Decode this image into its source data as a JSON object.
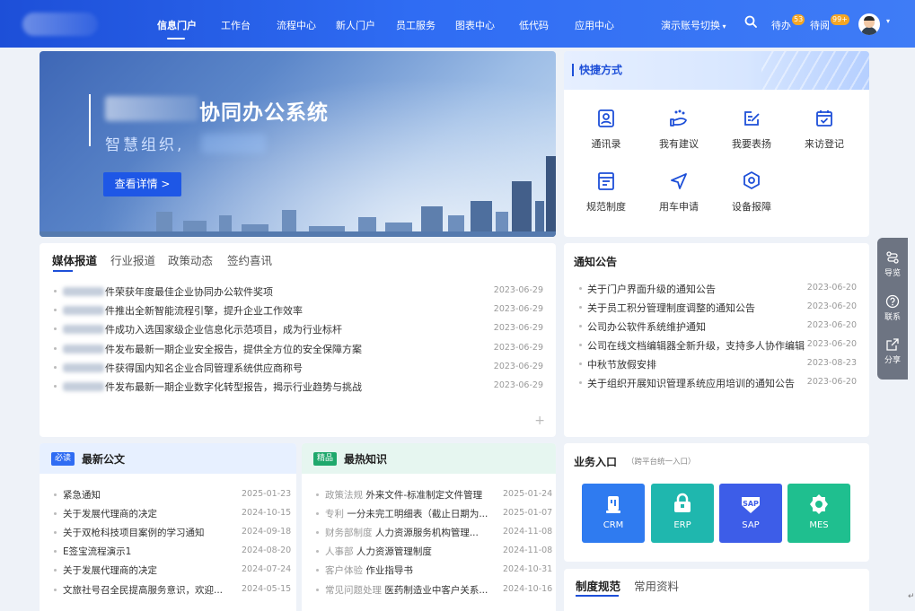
{
  "nav": {
    "items": [
      "信息门户",
      "工作台",
      "流程中心",
      "新人门户",
      "员工服务",
      "图表中心",
      "低代码",
      "应用中心"
    ],
    "active": "信息门户",
    "account_switch": "演示账号切换",
    "todo_label": "待办",
    "todo_count": "53",
    "toread_label": "待阅",
    "toread_count": "99+"
  },
  "banner": {
    "title": "协同办公系统",
    "subtitle": "智慧组织,",
    "button": "查看详情 >"
  },
  "quick": {
    "title": "快捷方式",
    "items": [
      {
        "label": "通讯录",
        "icon": "contact-book-icon"
      },
      {
        "label": "我有建议",
        "icon": "suggestion-icon"
      },
      {
        "label": "我要表扬",
        "icon": "praise-icon"
      },
      {
        "label": "来访登记",
        "icon": "visitor-register-icon"
      },
      {
        "label": "规范制度",
        "icon": "regulation-icon"
      },
      {
        "label": "用车申请",
        "icon": "car-request-icon"
      },
      {
        "label": "设备报障",
        "icon": "device-repair-icon"
      }
    ]
  },
  "media": {
    "tabs": [
      "媒体报道",
      "行业报道",
      "政策动态",
      "签约喜讯"
    ],
    "items": [
      {
        "title": "件荣获年度最佳企业协同办公软件奖项",
        "date": "2023-06-29"
      },
      {
        "title": "件推出全新智能流程引擎，提升企业工作效率",
        "date": "2023-06-29"
      },
      {
        "title": "件成功入选国家级企业信息化示范项目，成为行业标杆",
        "date": "2023-06-29"
      },
      {
        "title": "件发布最新一期企业安全报告，提供全方位的安全保障方案",
        "date": "2023-06-29"
      },
      {
        "title": "件获得国内知名企业合同管理系统供应商称号",
        "date": "2023-06-29"
      },
      {
        "title": "件发布最新一期企业数字化转型报告，揭示行业趋势与挑战",
        "date": "2023-06-29"
      }
    ],
    "more": "+"
  },
  "notice": {
    "title": "通知公告",
    "items": [
      {
        "title": "关于门户界面升级的通知公告",
        "date": "2023-06-20"
      },
      {
        "title": "关于员工积分管理制度调整的通知公告",
        "date": "2023-06-20"
      },
      {
        "title": "公司办公软件系统维护通知",
        "date": "2023-06-20"
      },
      {
        "title": "公司在线文档编辑器全新升级，支持多人协作编辑",
        "date": "2023-06-20"
      },
      {
        "title": "中秋节放假安排",
        "date": "2023-08-23"
      },
      {
        "title": "关于组织开展知识管理系统应用培训的通知公告",
        "date": "2023-06-20"
      }
    ]
  },
  "floatbar": {
    "items": [
      {
        "label": "导览",
        "icon": "guide-icon"
      },
      {
        "label": "联系",
        "icon": "help-contact-icon"
      },
      {
        "label": "分享",
        "icon": "share-icon"
      }
    ]
  },
  "documents": {
    "tag": "必读",
    "title": "最新公文",
    "items": [
      {
        "title": "紧急通知",
        "date": "2025-01-23"
      },
      {
        "title": "关于发展代理商的决定",
        "date": "2024-10-15"
      },
      {
        "title": "关于双枪科技项目案例的学习通知",
        "date": "2024-09-18"
      },
      {
        "title": "E签宝流程演示1",
        "date": "2024-08-20"
      },
      {
        "title": "关于发展代理商的决定",
        "date": "2024-07-24"
      },
      {
        "title": "文旅社号召全民提高服务意识，欢迎...",
        "date": "2024-05-15"
      }
    ]
  },
  "knowledge": {
    "tag": "精品",
    "title": "最热知识",
    "items": [
      {
        "category": "政策法规",
        "title": "外来文件-标准制定文件管理",
        "date": "2025-01-24"
      },
      {
        "category": "专利",
        "title": "一分未完工明细表（截止日期为...",
        "date": "2025-01-07"
      },
      {
        "category": "财务部制度",
        "title": "人力资源服务机构管理...",
        "date": "2024-11-08"
      },
      {
        "category": "人事部",
        "title": "人力资源管理制度",
        "date": "2024-11-08"
      },
      {
        "category": "客户体验",
        "title": "作业指导书",
        "date": "2024-10-31"
      },
      {
        "category": "常见问题处理",
        "title": "医药制造业中客户关系...",
        "date": "2024-10-16"
      }
    ]
  },
  "business": {
    "title": "业务入口",
    "subtitle": "（跨平台统一入口）",
    "items": [
      {
        "label": "CRM",
        "color": "#2f7bf0",
        "icon": "crm-icon"
      },
      {
        "label": "ERP",
        "color": "#1fb7ae",
        "icon": "erp-icon"
      },
      {
        "label": "SAP",
        "color": "#3d5de8",
        "icon": "sap-icon"
      },
      {
        "label": "MES",
        "color": "#1fbf8f",
        "icon": "mes-icon"
      }
    ]
  },
  "rules": {
    "tabs": [
      "制度规范",
      "常用资料"
    ]
  },
  "colors": {
    "primary": "#1d4fd8",
    "badge": "#f5a623"
  }
}
